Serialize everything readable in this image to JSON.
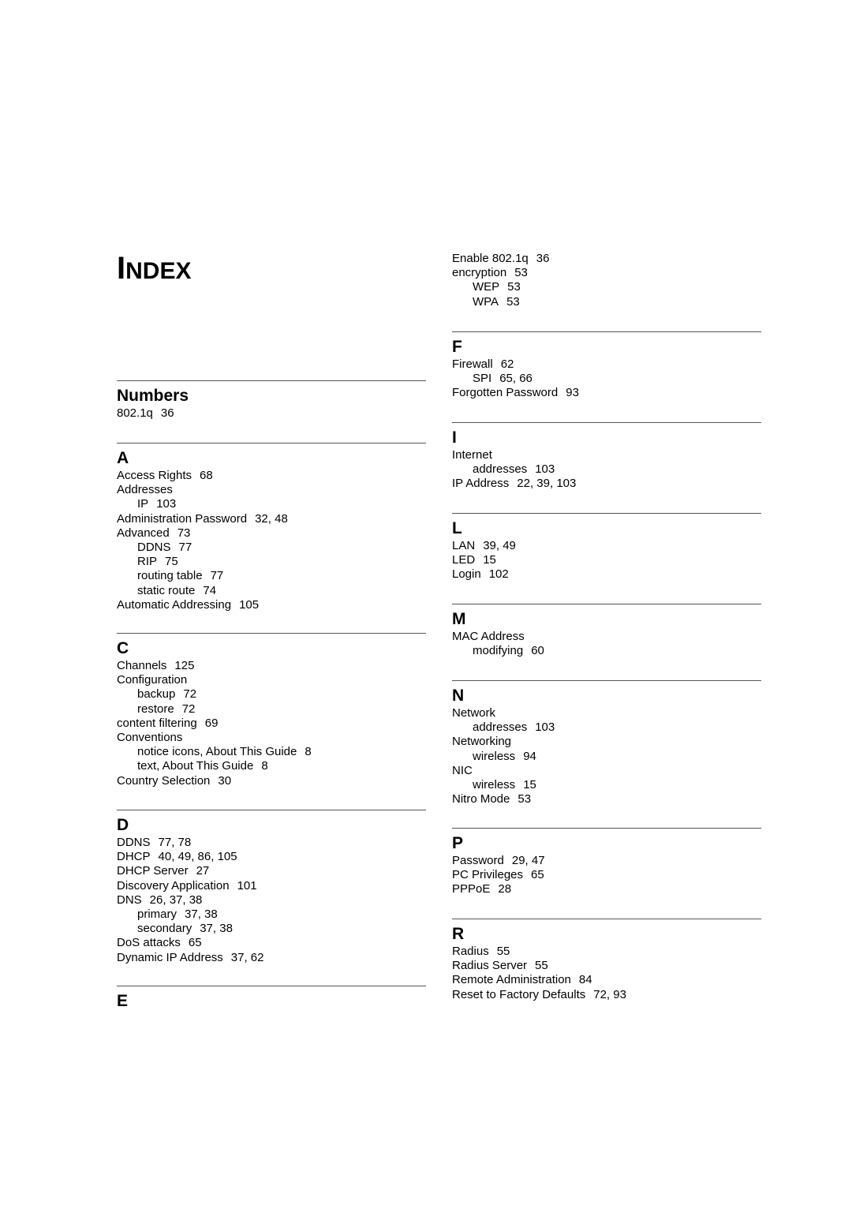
{
  "page": {
    "title_first": "I",
    "title_rest": "NDEX"
  },
  "top_entries": [
    {
      "term": "Enable 802.1q",
      "pages": "36",
      "level": 0
    },
    {
      "term": "encryption",
      "pages": "53",
      "level": 0
    },
    {
      "term": "WEP",
      "pages": "53",
      "level": 1
    },
    {
      "term": "WPA",
      "pages": "53",
      "level": 1
    }
  ],
  "sections": [
    {
      "id": "numbers",
      "heading": "Numbers",
      "entries": [
        {
          "term": "802.1q",
          "pages": "36",
          "level": 0
        }
      ]
    },
    {
      "id": "a",
      "heading": "A",
      "entries": [
        {
          "term": "Access Rights",
          "pages": "68",
          "level": 0
        },
        {
          "term": "Addresses",
          "pages": "",
          "level": 0
        },
        {
          "term": "IP",
          "pages": "103",
          "level": 1
        },
        {
          "term": "Administration Password",
          "pages": "32, 48",
          "level": 0
        },
        {
          "term": "Advanced",
          "pages": "73",
          "level": 0
        },
        {
          "term": "DDNS",
          "pages": "77",
          "level": 1
        },
        {
          "term": "RIP",
          "pages": "75",
          "level": 1
        },
        {
          "term": "routing table",
          "pages": "77",
          "level": 1
        },
        {
          "term": "static route",
          "pages": "74",
          "level": 1
        },
        {
          "term": "Automatic Addressing",
          "pages": "105",
          "level": 0
        }
      ]
    },
    {
      "id": "c",
      "heading": "C",
      "entries": [
        {
          "term": "Channels",
          "pages": "125",
          "level": 0
        },
        {
          "term": "Configuration",
          "pages": "",
          "level": 0
        },
        {
          "term": "backup",
          "pages": "72",
          "level": 1
        },
        {
          "term": "restore",
          "pages": "72",
          "level": 1
        },
        {
          "term": "content filtering",
          "pages": "69",
          "level": 0
        },
        {
          "term": "Conventions",
          "pages": "",
          "level": 0
        },
        {
          "term": "notice icons, About This Guide",
          "pages": "8",
          "level": 1
        },
        {
          "term": "text, About This Guide",
          "pages": "8",
          "level": 1
        },
        {
          "term": "Country Selection",
          "pages": "30",
          "level": 0
        }
      ]
    },
    {
      "id": "d",
      "heading": "D",
      "entries": [
        {
          "term": "DDNS",
          "pages": "77, 78",
          "level": 0
        },
        {
          "term": "DHCP",
          "pages": "40, 49, 86, 105",
          "level": 0
        },
        {
          "term": "DHCP Server",
          "pages": "27",
          "level": 0
        },
        {
          "term": "Discovery Application",
          "pages": "101",
          "level": 0
        },
        {
          "term": "DNS",
          "pages": "26, 37, 38",
          "level": 0
        },
        {
          "term": "primary",
          "pages": "37, 38",
          "level": 1
        },
        {
          "term": "secondary",
          "pages": "37, 38",
          "level": 1
        },
        {
          "term": "DoS attacks",
          "pages": "65",
          "level": 0
        },
        {
          "term": "Dynamic IP Address",
          "pages": "37, 62",
          "level": 0
        }
      ]
    },
    {
      "id": "e",
      "heading": "E",
      "entries": []
    },
    {
      "id": "f",
      "heading": "F",
      "entries": [
        {
          "term": "Firewall",
          "pages": "62",
          "level": 0
        },
        {
          "term": "SPI",
          "pages": "65, 66",
          "level": 1
        },
        {
          "term": "Forgotten Password",
          "pages": "93",
          "level": 0
        }
      ]
    },
    {
      "id": "i",
      "heading": "I",
      "entries": [
        {
          "term": "Internet",
          "pages": "",
          "level": 0
        },
        {
          "term": "addresses",
          "pages": "103",
          "level": 1
        },
        {
          "term": "IP Address",
          "pages": "22, 39, 103",
          "level": 0
        }
      ]
    },
    {
      "id": "l",
      "heading": "L",
      "entries": [
        {
          "term": "LAN",
          "pages": "39, 49",
          "level": 0
        },
        {
          "term": "LED",
          "pages": "15",
          "level": 0
        },
        {
          "term": "Login",
          "pages": "102",
          "level": 0
        }
      ]
    },
    {
      "id": "m",
      "heading": "M",
      "entries": [
        {
          "term": "MAC Address",
          "pages": "",
          "level": 0
        },
        {
          "term": "modifying",
          "pages": "60",
          "level": 1
        }
      ]
    },
    {
      "id": "n",
      "heading": "N",
      "entries": [
        {
          "term": "Network",
          "pages": "",
          "level": 0
        },
        {
          "term": "addresses",
          "pages": "103",
          "level": 1
        },
        {
          "term": "Networking",
          "pages": "",
          "level": 0
        },
        {
          "term": "wireless",
          "pages": "94",
          "level": 1
        },
        {
          "term": "NIC",
          "pages": "",
          "level": 0
        },
        {
          "term": "wireless",
          "pages": "15",
          "level": 1
        },
        {
          "term": "Nitro Mode",
          "pages": "53",
          "level": 0
        }
      ]
    },
    {
      "id": "p",
      "heading": "P",
      "entries": [
        {
          "term": "Password",
          "pages": "29, 47",
          "level": 0
        },
        {
          "term": "PC Privileges",
          "pages": "65",
          "level": 0
        },
        {
          "term": "PPPoE",
          "pages": "28",
          "level": 0
        }
      ]
    },
    {
      "id": "r",
      "heading": "R",
      "entries": [
        {
          "term": "Radius",
          "pages": "55",
          "level": 0
        },
        {
          "term": "Radius Server",
          "pages": "55",
          "level": 0
        },
        {
          "term": "Remote Administration",
          "pages": "84",
          "level": 0
        },
        {
          "term": "Reset to Factory Defaults",
          "pages": "72, 93",
          "level": 0
        }
      ]
    }
  ]
}
